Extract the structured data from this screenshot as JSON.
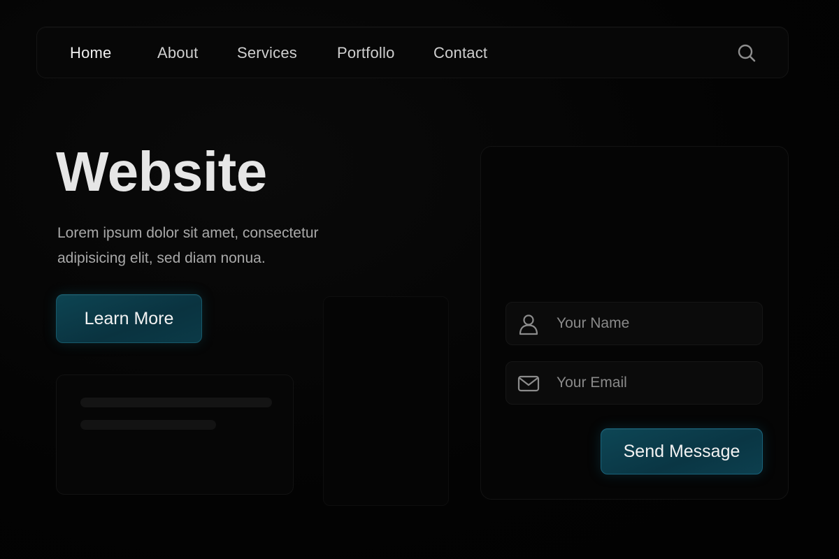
{
  "nav": {
    "items": [
      {
        "label": "Home",
        "active": true
      },
      {
        "label": "About"
      },
      {
        "label": "Services"
      },
      {
        "label": "Portfollo"
      },
      {
        "label": "Contact"
      }
    ],
    "search_icon": "search-icon"
  },
  "hero": {
    "title": "Website",
    "text": "Lorem ipsum dolor sit amet, consectetur adipisicing elit, sed diam nonua.",
    "cta_label": "Learn More"
  },
  "contact_form": {
    "name_placeholder": "Your Name",
    "name_value": "",
    "email_placeholder": "Your Email",
    "email_value": "",
    "name_icon": "user-icon",
    "email_icon": "mail-icon",
    "submit_label": "Send Message"
  },
  "colors": {
    "background": "#030303",
    "accent": "#0b3a47",
    "accent_border": "#17596a",
    "text_primary": "#e6e6e6",
    "text_muted": "#a9a9a9"
  }
}
